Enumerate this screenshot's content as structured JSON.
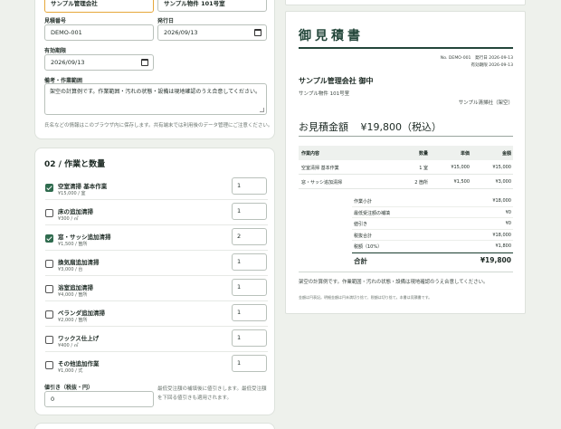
{
  "form": {
    "client_name": "サンプル管理会社",
    "property_name": "サンプル物件 101号室",
    "quote_no_label": "見積番号",
    "quote_no_value": "DEMO-001",
    "issue_date_label": "発行日",
    "issue_date_value": "2026/09/13",
    "valid_until_label": "有効期限",
    "valid_until_value": "2026/09/13",
    "remarks_label": "備考・作業範囲",
    "remarks_value": "架空の計算例です。作業範囲・汚れの状態・設備は現地確認のうえ合意してください。",
    "storage_note": "氏名などの情報はこのブラウザ内に保存します。共有端末では利用後のデータ管理にご注意ください。"
  },
  "work": {
    "title": "02 / 作業と数量",
    "items": [
      {
        "name": "空室清掃 基本作業",
        "price": "¥15,000 / 室",
        "qty": "1",
        "checked": true
      },
      {
        "name": "床の追加清掃",
        "price": "¥300 / ㎡",
        "qty": "1",
        "checked": false
      },
      {
        "name": "窓・サッシ追加清掃",
        "price": "¥1,500 / 箇所",
        "qty": "2",
        "checked": true
      },
      {
        "name": "換気扇追加清掃",
        "price": "¥3,000 / 台",
        "qty": "1",
        "checked": false
      },
      {
        "name": "浴室追加清掃",
        "price": "¥4,000 / 箇所",
        "qty": "1",
        "checked": false
      },
      {
        "name": "ベランダ追加清掃",
        "price": "¥2,000 / 箇所",
        "qty": "1",
        "checked": false
      },
      {
        "name": "ワックス仕上げ",
        "price": "¥400 / ㎡",
        "qty": "1",
        "checked": false
      },
      {
        "name": "その他追加作業",
        "price": "¥1,000 / 式",
        "qty": "1",
        "checked": false
      }
    ],
    "discount_label": "値引き（税抜・円）",
    "discount_value": "0",
    "discount_note": "最低受注額の補填後に値引きします。最低受注額を下回る値引きも適用されます。"
  },
  "quote": {
    "title": "御見積書",
    "no_line": "No. DEMO-001　発行日 2026-09-13",
    "valid_line": "有効期限 2026-09-13",
    "client": "サンプル管理会社 御中",
    "property": "サンプル物件 101号室",
    "issuer": "サンプル清掃社（架空）",
    "amount_label": "お見積金額",
    "amount_value": "¥19,800（税込）",
    "headers": [
      "作業内容",
      "数量",
      "単価",
      "金額"
    ],
    "rows": [
      [
        "空室清掃 基本作業",
        "1 室",
        "¥15,000",
        "¥15,000"
      ],
      [
        "窓・サッシ追加清掃",
        "2 箇所",
        "¥1,500",
        "¥3,000"
      ]
    ],
    "summary": [
      {
        "label": "作業小計",
        "value": "¥18,000"
      },
      {
        "label": "最低受注額の補填",
        "value": "¥0"
      },
      {
        "label": "値引き",
        "value": "¥0"
      },
      {
        "label": "税抜合計",
        "value": "¥18,000"
      },
      {
        "label": "税額（10%）",
        "value": "¥1,800"
      }
    ],
    "total_label": "合計",
    "total_value": "¥19,800",
    "remark": "架空の計算例です。作業範囲・汚れの状態・設備は現地確認のうえ合意してください。",
    "footnote": "金額は円表記。明細金額は円未満切り捨て、税額は切り捨て。本書は見積書です。"
  },
  "colors": {
    "accent": "#2f6b4e",
    "focus": "#e6a83a",
    "heading": "#23463a"
  }
}
